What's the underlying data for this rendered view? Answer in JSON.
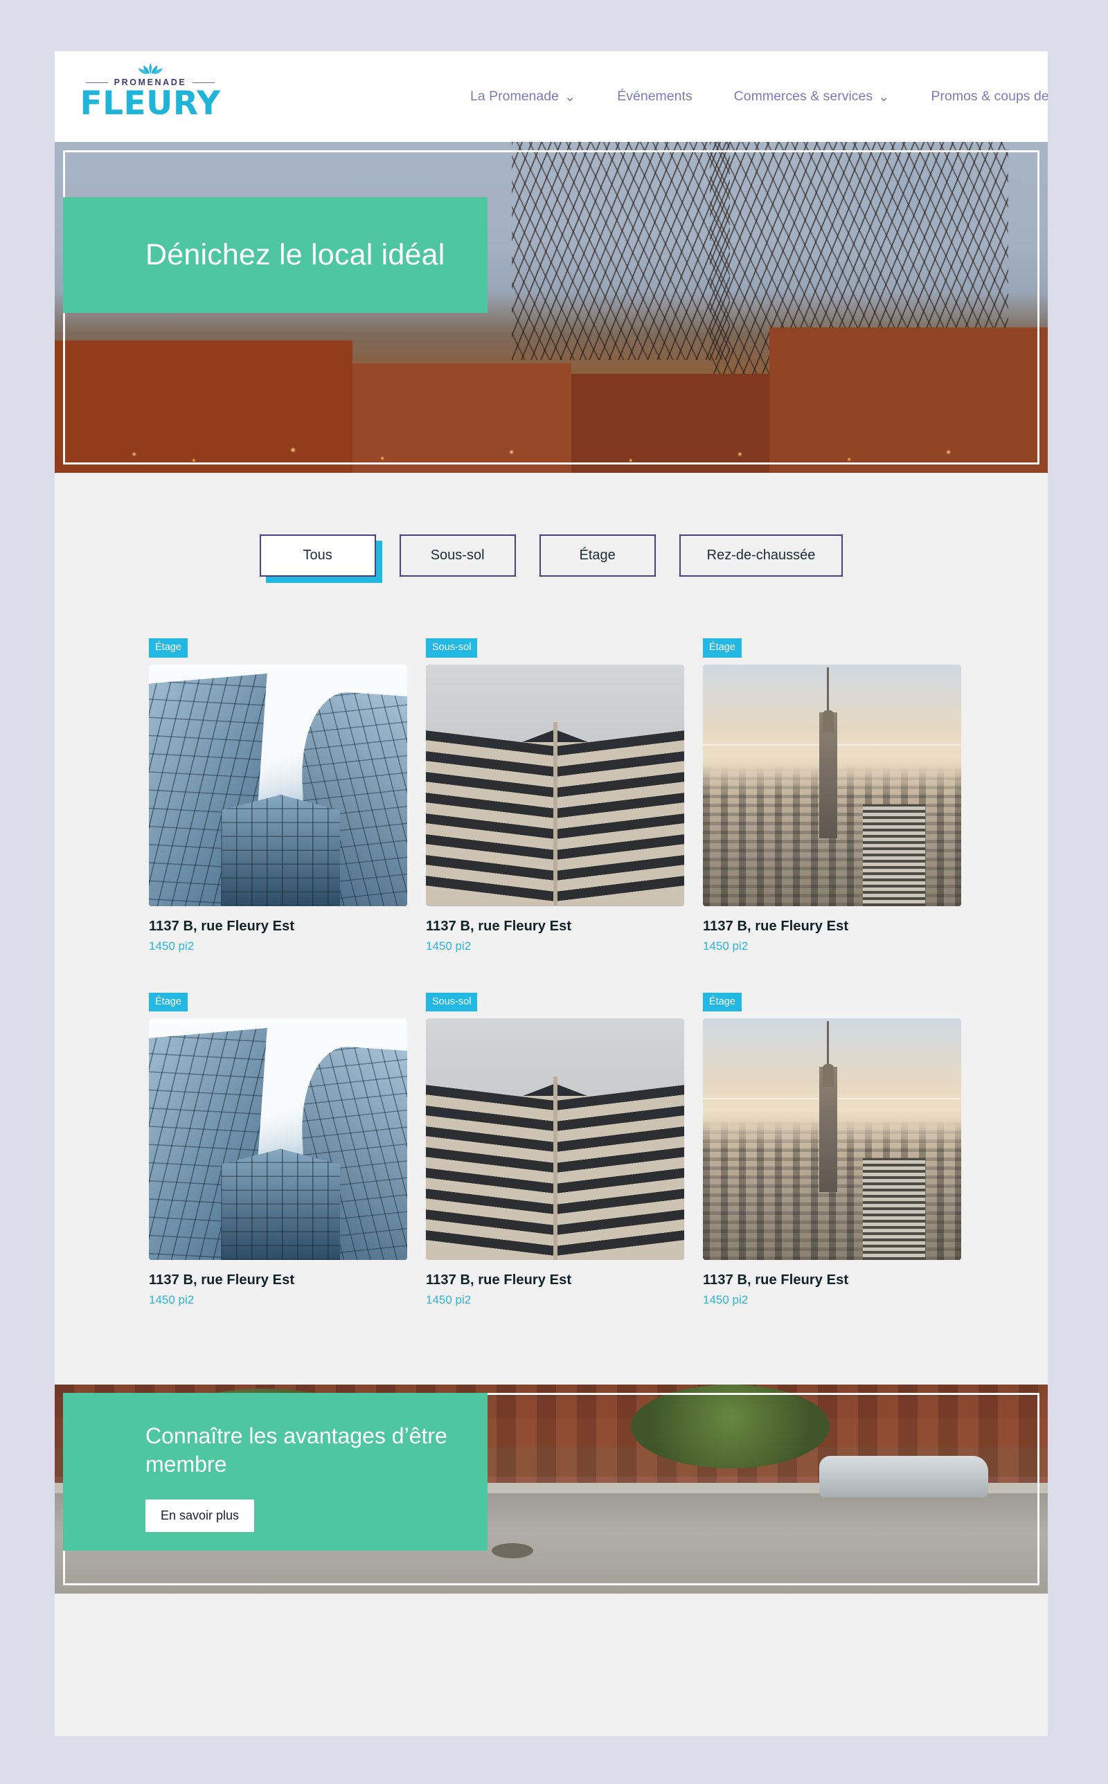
{
  "header": {
    "logo": {
      "crown_icon": "leaf-crown-icon",
      "top_word": "PROMENADE",
      "brand": "FLEURY"
    },
    "nav": [
      {
        "label": "La Promenade",
        "has_dropdown": true
      },
      {
        "label": "Événements",
        "has_dropdown": false
      },
      {
        "label": "Commerces & services",
        "has_dropdown": true
      },
      {
        "label": "Promos & coups de",
        "has_dropdown": false
      }
    ],
    "chevron_glyph": "⌄"
  },
  "hero": {
    "title": "Dénichez le local idéal"
  },
  "filters": {
    "items": [
      {
        "label": "Tous",
        "active": true
      },
      {
        "label": "Sous-sol",
        "active": false
      },
      {
        "label": "Étage",
        "active": false
      },
      {
        "label": "Rez-de-chaussée",
        "active": false
      }
    ]
  },
  "listings": [
    {
      "badge": "Étage",
      "title": "1137 B, rue Fleury Est",
      "area": "1450 pi2",
      "image": "glass-towers"
    },
    {
      "badge": "Sous-sol",
      "title": "1137 B, rue Fleury Est",
      "area": "1450 pi2",
      "image": "office-corner"
    },
    {
      "badge": "Étage",
      "title": "1137 B, rue Fleury Est",
      "area": "1450 pi2",
      "image": "city-skyline"
    },
    {
      "badge": "Étage",
      "title": "1137 B, rue Fleury Est",
      "area": "1450 pi2",
      "image": "glass-towers"
    },
    {
      "badge": "Sous-sol",
      "title": "1137 B, rue Fleury Est",
      "area": "1450 pi2",
      "image": "office-corner"
    },
    {
      "badge": "Étage",
      "title": "1137 B, rue Fleury Est",
      "area": "1450 pi2",
      "image": "city-skyline"
    }
  ],
  "cta": {
    "title": "Connaître les avantages d’être membre",
    "button_label": "En savoir plus"
  },
  "colors": {
    "page_background": "#dcdcea",
    "content_background": "#f1f1f1",
    "brand_cyan": "#20b4d8",
    "brand_navy": "#3c3c73",
    "accent_green": "#4ec69f",
    "badge_cyan": "#22b8e3",
    "filter_border": "#4a3f84",
    "filter_shadow": "#21b8e0",
    "title_dark": "#102027",
    "nav_text": "#7b7bb5"
  }
}
